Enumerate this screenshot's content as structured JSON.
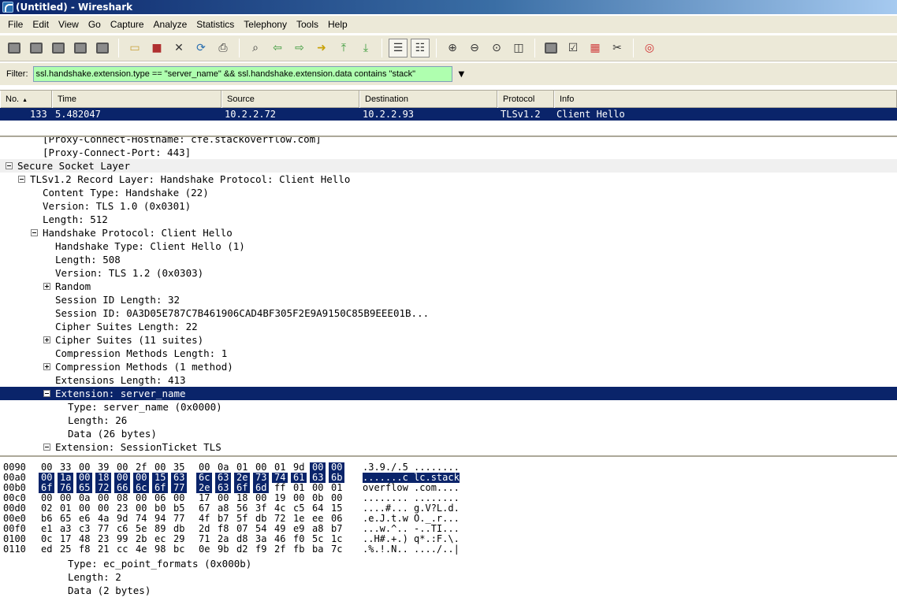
{
  "window": {
    "title": "(Untitled) - Wireshark"
  },
  "menu": [
    "File",
    "Edit",
    "View",
    "Go",
    "Capture",
    "Analyze",
    "Statistics",
    "Telephony",
    "Tools",
    "Help"
  ],
  "filter": {
    "label": "Filter:",
    "value": "ssl.handshake.extension.type == \"server_name\" && ssl.handshake.extension.data contains \"stack\"",
    "bg_color": "#afffaf"
  },
  "packet_list": {
    "columns": [
      "No.",
      "Time",
      "Source",
      "Destination",
      "Protocol",
      "Info"
    ],
    "rows": [
      {
        "no": "133",
        "time": "5.482047",
        "source": "10.2.2.72",
        "destination": "10.2.2.93",
        "protocol": "TLSv1.2",
        "info": "Client Hello"
      }
    ]
  },
  "details": [
    {
      "text": "[Proxy-Connect-Hostname: cfe.stackoverflow.com]",
      "indent": 2
    },
    {
      "text": "[Proxy-Connect-Port: 443]",
      "indent": 2
    },
    {
      "text": "Secure Socket Layer",
      "indent": 0,
      "expander": "expanded",
      "shaded": true
    },
    {
      "text": "TLSv1.2 Record Layer: Handshake Protocol: Client Hello",
      "indent": 1,
      "expander": "expanded"
    },
    {
      "text": "Content Type: Handshake (22)",
      "indent": 2
    },
    {
      "text": "Version: TLS 1.0 (0x0301)",
      "indent": 2
    },
    {
      "text": "Length: 512",
      "indent": 2
    },
    {
      "text": "Handshake Protocol: Client Hello",
      "indent": 2,
      "expander": "expanded"
    },
    {
      "text": "Handshake Type: Client Hello (1)",
      "indent": 3
    },
    {
      "text": "Length: 508",
      "indent": 3
    },
    {
      "text": "Version: TLS 1.2 (0x0303)",
      "indent": 3
    },
    {
      "text": "Random",
      "indent": 3,
      "expander": "collapsed"
    },
    {
      "text": "Session ID Length: 32",
      "indent": 3
    },
    {
      "text": "Session ID: 0A3D05E787C7B461906CAD4BF305F2E9A9150C85B9EEE01B...",
      "indent": 3
    },
    {
      "text": "Cipher Suites Length: 22",
      "indent": 3
    },
    {
      "text": "Cipher Suites (11 suites)",
      "indent": 3,
      "expander": "collapsed"
    },
    {
      "text": "Compression Methods Length: 1",
      "indent": 3
    },
    {
      "text": "Compression Methods (1 method)",
      "indent": 3,
      "expander": "collapsed"
    },
    {
      "text": "Extensions Length: 413",
      "indent": 3
    },
    {
      "text": "Extension: server_name",
      "indent": 3,
      "expander": "expanded",
      "selected": true
    },
    {
      "text": "Type: server_name (0x0000)",
      "indent": 4
    },
    {
      "text": "Length: 26",
      "indent": 4
    },
    {
      "text": "Data (26 bytes)",
      "indent": 4
    },
    {
      "text": "Extension: SessionTicket TLS",
      "indent": 3,
      "expander": "expanded"
    }
  ],
  "hex": [
    {
      "offset": "0090",
      "bytes": [
        "00",
        "33",
        "00",
        "39",
        "00",
        "2f",
        "00",
        "35",
        "00",
        "0a",
        "01",
        "00",
        "01",
        "9d",
        "00",
        "00"
      ],
      "ascii": ".3.9./.5 ........",
      "hl_from": 14
    },
    {
      "offset": "00a0",
      "bytes": [
        "00",
        "1a",
        "00",
        "18",
        "00",
        "00",
        "15",
        "63",
        "6c",
        "63",
        "2e",
        "73",
        "74",
        "61",
        "63",
        "6b"
      ],
      "ascii": ".......c lc.stack",
      "hl_from": 0
    },
    {
      "offset": "00b0",
      "bytes": [
        "6f",
        "76",
        "65",
        "72",
        "66",
        "6c",
        "6f",
        "77",
        "2e",
        "63",
        "6f",
        "6d",
        "ff",
        "01",
        "00",
        "01"
      ],
      "ascii": "overflow .com....",
      "hl_to": 12
    },
    {
      "offset": "00c0",
      "bytes": [
        "00",
        "00",
        "0a",
        "00",
        "08",
        "00",
        "06",
        "00",
        "17",
        "00",
        "18",
        "00",
        "19",
        "00",
        "0b",
        "00"
      ],
      "ascii": "........ ........"
    },
    {
      "offset": "00d0",
      "bytes": [
        "02",
        "01",
        "00",
        "00",
        "23",
        "00",
        "b0",
        "b5",
        "67",
        "a8",
        "56",
        "3f",
        "4c",
        "c5",
        "64",
        "15"
      ],
      "ascii": "....#... g.V?L.d."
    },
    {
      "offset": "00e0",
      "bytes": [
        "b6",
        "65",
        "e6",
        "4a",
        "9d",
        "74",
        "94",
        "77",
        "4f",
        "b7",
        "5f",
        "db",
        "72",
        "1e",
        "ee",
        "06"
      ],
      "ascii": ".e.J.t.w O._.r..."
    },
    {
      "offset": "00f0",
      "bytes": [
        "e1",
        "a3",
        "c3",
        "77",
        "c6",
        "5e",
        "89",
        "db",
        "2d",
        "f8",
        "07",
        "54",
        "49",
        "e9",
        "a8",
        "b7"
      ],
      "ascii": "...w.^.. -..TI..."
    },
    {
      "offset": "0100",
      "bytes": [
        "0c",
        "17",
        "48",
        "23",
        "99",
        "2b",
        "ec",
        "29",
        "71",
        "2a",
        "d8",
        "3a",
        "46",
        "f0",
        "5c",
        "1c"
      ],
      "ascii": "..H#.+.) q*.:F.\\."
    },
    {
      "offset": "0110",
      "bytes": [
        "ed",
        "25",
        "f8",
        "21",
        "cc",
        "4e",
        "98",
        "bc",
        "0e",
        "9b",
        "d2",
        "f9",
        "2f",
        "fb",
        "ba",
        "7c"
      ],
      "ascii": ".%.!.N.. ..../..|"
    }
  ],
  "lower_details": [
    {
      "text": "Type: ec_point_formats (0x000b)",
      "indent": 4
    },
    {
      "text": "Length: 2",
      "indent": 4
    },
    {
      "text": "Data (2 bytes)",
      "indent": 4
    }
  ],
  "colors": {
    "selection": "#0a246a",
    "chrome": "#ece9d8",
    "filter_ok": "#afffaf"
  }
}
